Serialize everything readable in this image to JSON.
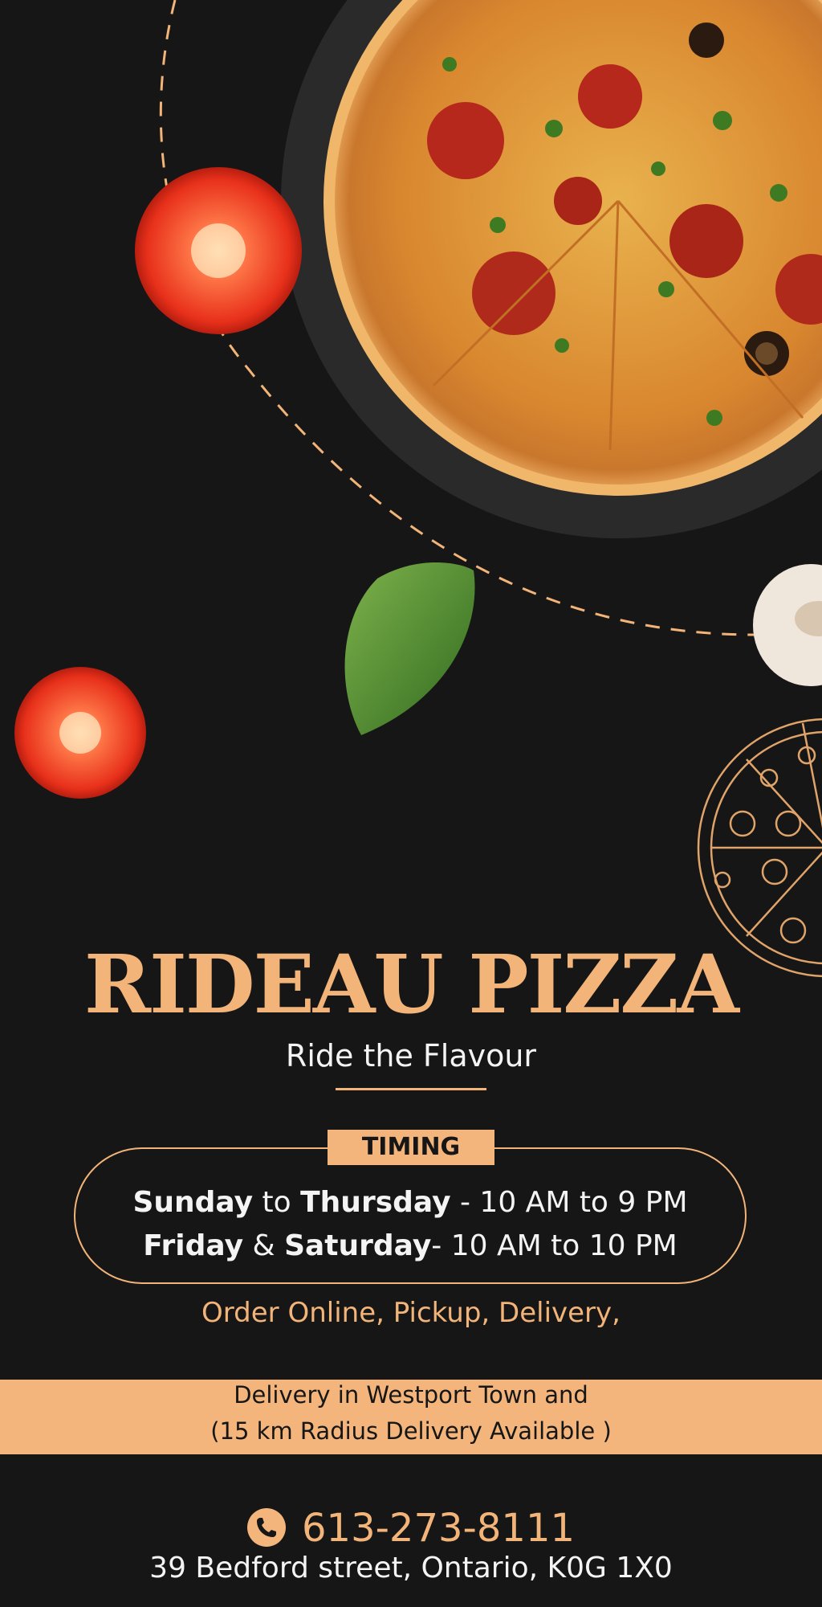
{
  "brand": {
    "name": "RIDEAU PIZZA",
    "tagline": "Ride the Flavour",
    "accent_color": "#f2b478",
    "background_color": "#161616"
  },
  "timing": {
    "label": "TIMING",
    "weekday": {
      "day_start": "Sunday",
      "joiner": "to",
      "day_end": "Thursday",
      "hours": "- 10 AM to 9 PM"
    },
    "weekend": {
      "day_start": "Friday",
      "joiner": "&",
      "day_end": "Saturday",
      "hours": "- 10 AM to 10 PM"
    }
  },
  "services": "Order Online, Pickup, Delivery,",
  "delivery": {
    "line1": "Delivery in Westport Town and",
    "line2": "(15 km Radius Delivery Available )"
  },
  "contact": {
    "phone": "613-273-8111",
    "phone_icon": "phone-icon",
    "address": "39 Bedford street, Ontario, K0G 1X0"
  },
  "decorations": [
    "pizza-photo",
    "tomato-slice",
    "basil-leaf",
    "mushroom",
    "pizza-line-art",
    "dashed-arc"
  ]
}
